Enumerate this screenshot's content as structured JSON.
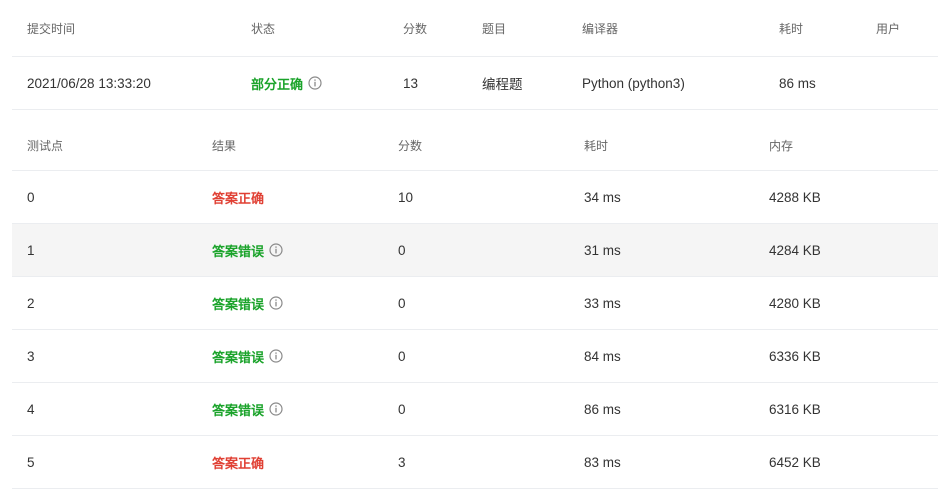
{
  "submission": {
    "headers": {
      "time": "提交时间",
      "status": "状态",
      "score": "分数",
      "problem": "题目",
      "compiler": "编译器",
      "duration": "耗时",
      "user": "用户"
    },
    "row": {
      "time": "2021/06/28 13:33:20",
      "status": "部分正确",
      "score": "13",
      "problem": "编程题",
      "compiler": "Python (python3)",
      "duration": "86 ms",
      "user": ""
    }
  },
  "testcases": {
    "headers": {
      "point": "测试点",
      "result": "结果",
      "score": "分数",
      "duration": "耗时",
      "memory": "内存"
    },
    "rows": [
      {
        "point": "0",
        "result": "答案正确",
        "correct": true,
        "score": "10",
        "duration": "34 ms",
        "memory": "4288 KB"
      },
      {
        "point": "1",
        "result": "答案错误",
        "correct": false,
        "score": "0",
        "duration": "31 ms",
        "memory": "4284 KB"
      },
      {
        "point": "2",
        "result": "答案错误",
        "correct": false,
        "score": "0",
        "duration": "33 ms",
        "memory": "4280 KB"
      },
      {
        "point": "3",
        "result": "答案错误",
        "correct": false,
        "score": "0",
        "duration": "84 ms",
        "memory": "6336 KB"
      },
      {
        "point": "4",
        "result": "答案错误",
        "correct": false,
        "score": "0",
        "duration": "86 ms",
        "memory": "6316 KB"
      },
      {
        "point": "5",
        "result": "答案正确",
        "correct": true,
        "score": "3",
        "duration": "83 ms",
        "memory": "6452 KB"
      }
    ]
  },
  "icons": {
    "info": "info-circle-icon"
  },
  "colors": {
    "correct": "#e04034",
    "wrong": "#1aa32a",
    "partial": "#1aa32a",
    "stripe": "#f5f5f5",
    "divider": "#ebedf0"
  }
}
